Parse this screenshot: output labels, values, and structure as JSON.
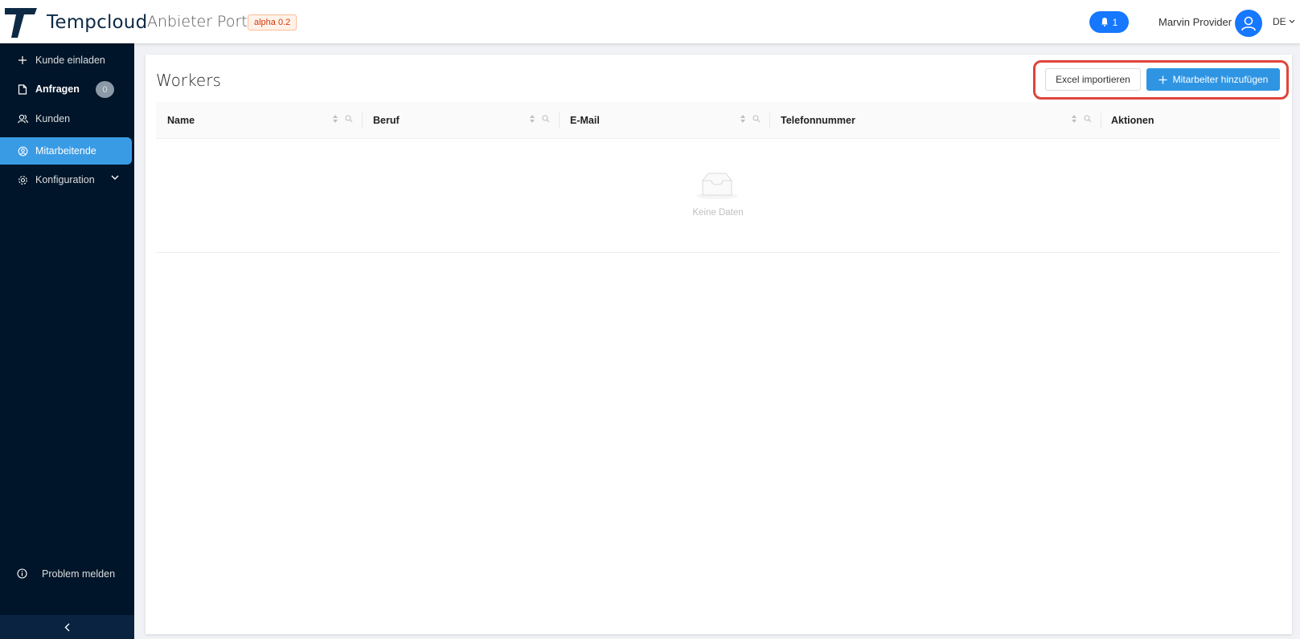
{
  "header": {
    "brand": "Tempcloud",
    "portal": "Anbieter Portal",
    "version": "alpha 0.2",
    "notifications": "1",
    "user_name": "Marvin Provider",
    "language": "DE"
  },
  "sidebar": {
    "items": [
      {
        "label": "Kunde einladen",
        "icon": "plus-icon"
      },
      {
        "label": "Anfragen",
        "icon": "file-icon",
        "badge": "0"
      },
      {
        "label": "Kunden",
        "icon": "users-icon"
      },
      {
        "label": "Mitarbeitende",
        "icon": "worker-icon",
        "active": true
      },
      {
        "label": "Konfiguration",
        "icon": "gear-icon"
      }
    ],
    "problem_label": "Problem melden"
  },
  "main": {
    "title": "Workers",
    "excel_button": "Excel importieren",
    "add_button": "Mitarbeiter hinzufügen",
    "columns": [
      "Name",
      "Beruf",
      "E-Mail",
      "Telefonnummer",
      "Aktionen"
    ],
    "empty_text": "Keine Daten"
  },
  "colors": {
    "sidebar_bg": "#001529",
    "active_item": "#3a9be5",
    "primary": "#1677ff",
    "highlight_box": "#e0453a"
  }
}
